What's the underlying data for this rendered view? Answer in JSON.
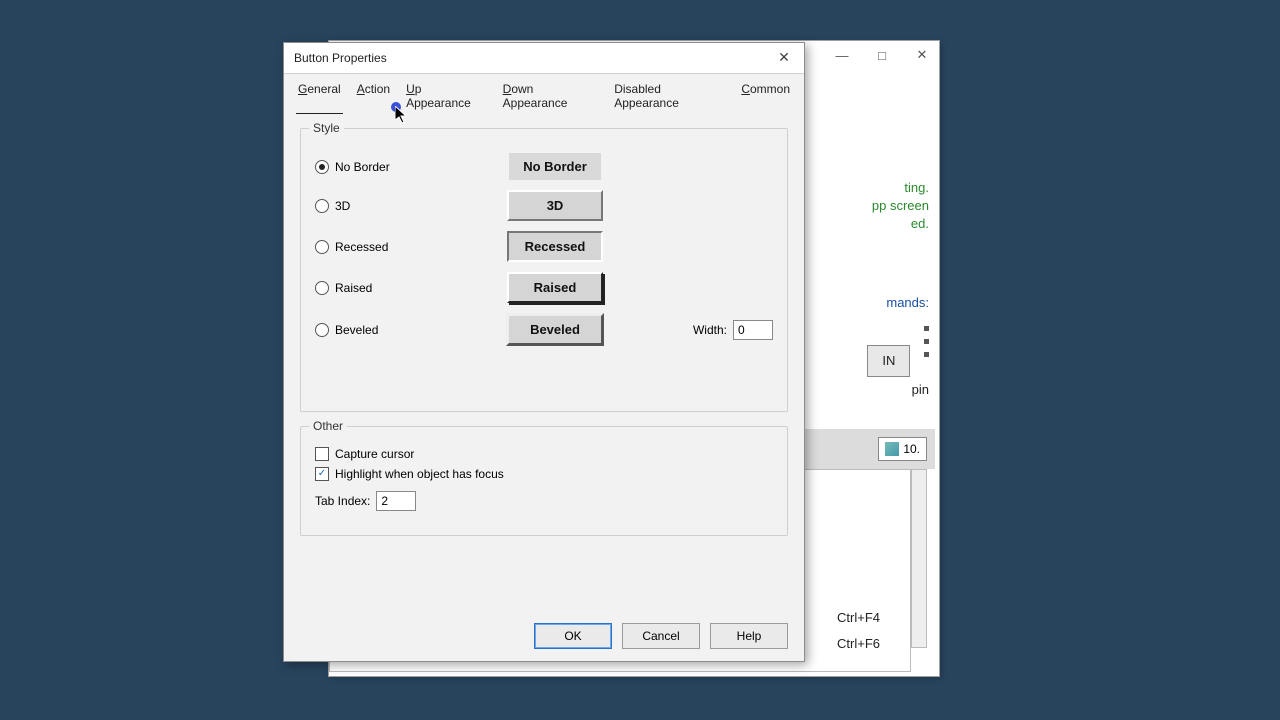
{
  "parent": {
    "window_buttons": {
      "min": "—",
      "max": "□",
      "close": "✕"
    },
    "text1": "ting.",
    "text2": "pp screen",
    "text3": "ed.",
    "mands": "mands:",
    "login_btn": "IN",
    "pin": "pin",
    "tab_label": "10.",
    "shortcut1": "Ctrl+F4",
    "shortcut2": "Ctrl+F6"
  },
  "dialog": {
    "title": "Button Properties",
    "tabs": [
      "General",
      "Action",
      "Up Appearance",
      "Down Appearance",
      "Disabled Appearance",
      "Common"
    ],
    "active_tab": 0,
    "style": {
      "legend": "Style",
      "options": [
        "No Border",
        "3D",
        "Recessed",
        "Raised",
        "Beveled"
      ],
      "selected": 0,
      "previews": [
        "No Border",
        "3D",
        "Recessed",
        "Raised",
        "Beveled"
      ],
      "width_label": "Width:",
      "width_value": "0"
    },
    "other": {
      "legend": "Other",
      "capture_cursor": {
        "label": "Capture cursor",
        "checked": false
      },
      "highlight": {
        "label": "Highlight when object has focus",
        "checked": true
      },
      "tabindex_label": "Tab Index:",
      "tabindex_value": "2"
    },
    "buttons": {
      "ok": "OK",
      "cancel": "Cancel",
      "help": "Help"
    }
  }
}
